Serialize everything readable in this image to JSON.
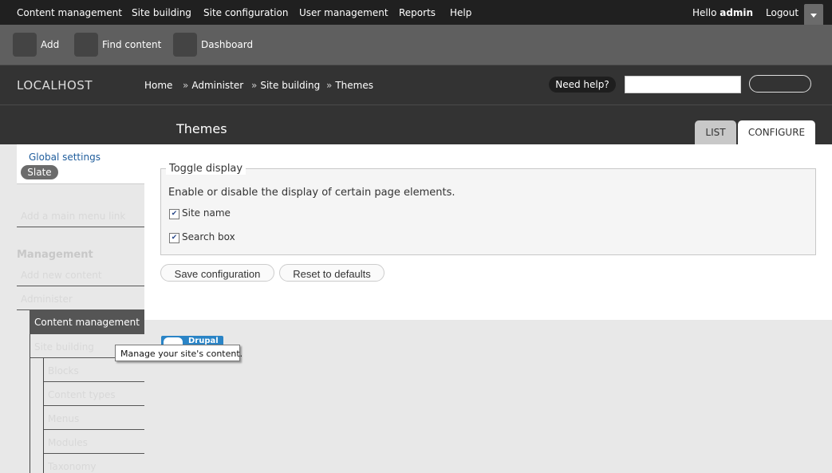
{
  "adminbar": {
    "menu": [
      "Content management",
      "Site building",
      "Site configuration",
      "User management",
      "Reports",
      "Help"
    ],
    "hello_prefix": "Hello ",
    "username": "admin",
    "logout": "Logout"
  },
  "shortcuts": [
    "Add",
    "Find content",
    "Dashboard"
  ],
  "header": {
    "site_name": "LOCALHOST",
    "breadcrumb": [
      {
        "label": "Home",
        "sep": ""
      },
      {
        "label": "Administer",
        "sep": "»"
      },
      {
        "label": "Site building",
        "sep": "»"
      },
      {
        "label": "Themes",
        "sep": "»"
      }
    ],
    "help_label": "Need help?",
    "search_value": "",
    "search_button": ""
  },
  "page": {
    "title": "Themes",
    "tabs": [
      "LIST",
      "CONFIGURE"
    ],
    "active_tab": "CONFIGURE"
  },
  "sidebar": {
    "global_settings": "Global settings",
    "active_theme": "Slate",
    "add_menu_link": "Add a main menu link",
    "management_heading": "Management",
    "add_new_content": "Add new content",
    "administer": "Administer",
    "content_management": "Content management",
    "site_building": "Site building",
    "sub_items": [
      "Blocks",
      "Content types",
      "Menus",
      "Modules",
      "Taxonomy"
    ]
  },
  "form": {
    "legend": "Toggle display",
    "description": "Enable or disable the display of certain page elements.",
    "checkboxes": [
      {
        "label": "Site name",
        "checked": true
      },
      {
        "label": "Search box",
        "checked": true
      }
    ],
    "save_button": "Save configuration",
    "reset_button": "Reset to defaults"
  },
  "badge": {
    "text": "Drupal"
  },
  "tooltip": {
    "text": "Manage your site's content."
  }
}
